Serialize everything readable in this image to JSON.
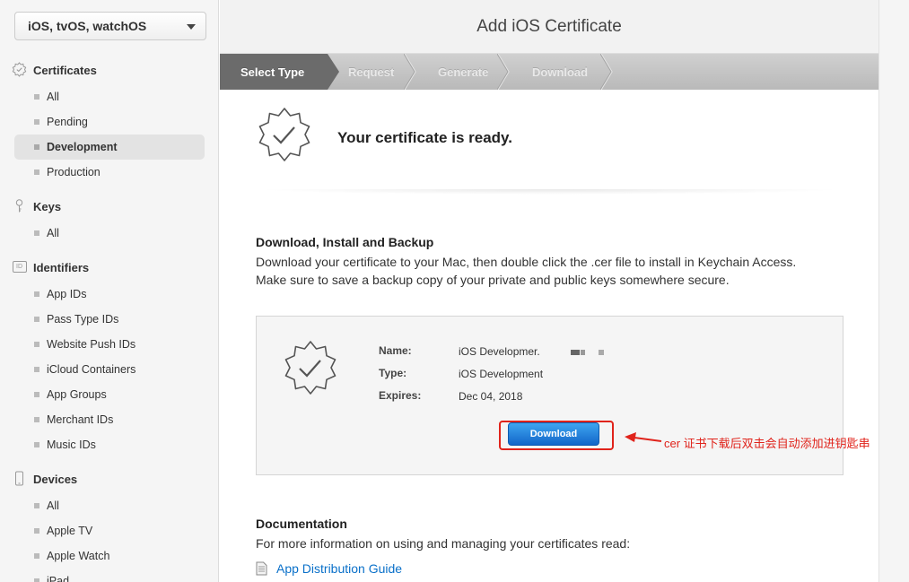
{
  "sidebar": {
    "platform": "iOS, tvOS, watchOS",
    "certificates": {
      "title": "Certificates",
      "items": [
        "All",
        "Pending",
        "Development",
        "Production"
      ]
    },
    "keys": {
      "title": "Keys",
      "items": [
        "All"
      ]
    },
    "identifiers": {
      "title": "Identifiers",
      "icon_text": "ID",
      "items": [
        "App IDs",
        "Pass Type IDs",
        "Website Push IDs",
        "iCloud Containers",
        "App Groups",
        "Merchant IDs",
        "Music IDs"
      ]
    },
    "devices": {
      "title": "Devices",
      "items": [
        "All",
        "Apple TV",
        "Apple Watch",
        "iPad"
      ]
    }
  },
  "main": {
    "title": "Add iOS Certificate",
    "steps": [
      "Select Type",
      "Request",
      "Generate",
      "Download"
    ],
    "ready_text": "Your certificate is ready.",
    "download_section": {
      "title": "Download, Install and Backup",
      "text": "Download your certificate to your Mac, then double click the .cer file to install in Keychain Access. Make sure to save a backup copy of your private and public keys somewhere secure."
    },
    "certificate": {
      "name_label": "Name:",
      "name_value": "iOS Developmer.",
      "type_label": "Type:",
      "type_value": "iOS Development",
      "expires_label": "Expires:",
      "expires_value": "Dec 04, 2018",
      "download_label": "Download"
    },
    "annotation": "cer 证书下载后双击会自动添加进钥匙串",
    "documentation": {
      "title": "Documentation",
      "text": "For more information on using and managing your certificates read:",
      "link": "App Distribution Guide"
    }
  },
  "colors": {
    "accent_blue": "#1a78d4",
    "link_blue": "#0a70c9",
    "annotation_red": "#e0231b"
  }
}
